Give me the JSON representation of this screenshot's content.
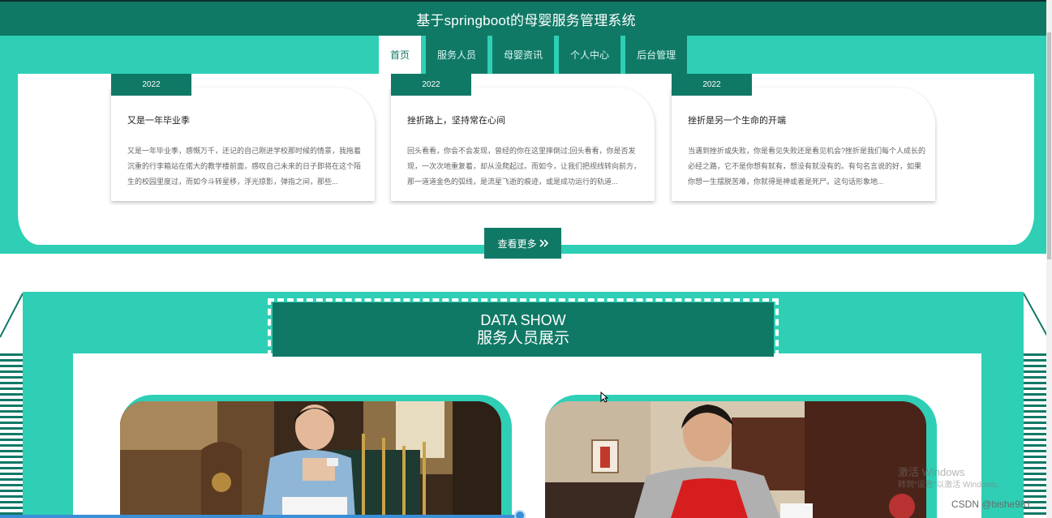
{
  "header": {
    "title": "基于springboot的母婴服务管理系统"
  },
  "nav": {
    "items": [
      {
        "label": "首页",
        "active": true
      },
      {
        "label": "服务人员",
        "active": false
      },
      {
        "label": "母婴资讯",
        "active": false
      },
      {
        "label": "个人中心",
        "active": false
      },
      {
        "label": "后台管理",
        "active": false
      }
    ]
  },
  "news": {
    "cards": [
      {
        "year": "2022",
        "title": "又是一年毕业季",
        "excerpt": "又是一年毕业季，感慨万千，还记的自己刚进学校那时候的情景，我拖着沉重的行李箱站在偌大的教学楼前面，感叹自己未来的日子即将在这个陌生的校园里度过，而如今斗转星移，浮光掠影，弹指之间，那些..."
      },
      {
        "year": "2022",
        "title": "挫折路上，坚持常在心间",
        "excerpt": "回头看看，你会不会发现，曾经的你在这里摔倒过;回头看看，你是否发现，一次次地重复着，却从没爬起过。而如今，让我们把视线转向前方，那一道道金色的弧线，是流星飞逝的痕迹，或是成功运行的轨道..."
      },
      {
        "year": "2022",
        "title": "挫折是另一个生命的开端",
        "excerpt": "当遇到挫折或失败，你是看见失败还是看见机会?挫折是我们每个人成长的必经之路，它不是你想有就有，想没有就没有的。有句名言说的好，如果你想一生摆脱苦难，你就得是神或者是死尸。这句话形象地..."
      }
    ],
    "more_label": "查看更多"
  },
  "data_show": {
    "title_en": "DATA SHOW",
    "title_zh": "服务人员展示"
  },
  "overlay": {
    "watermark_line1": "激活 Windows",
    "watermark_line2": "转到\"设置\"以激活 Windows。",
    "csdn_label": "CSDN @bishe981"
  },
  "colors": {
    "dark_teal": "#107966",
    "light_teal": "#2ecfb5"
  }
}
